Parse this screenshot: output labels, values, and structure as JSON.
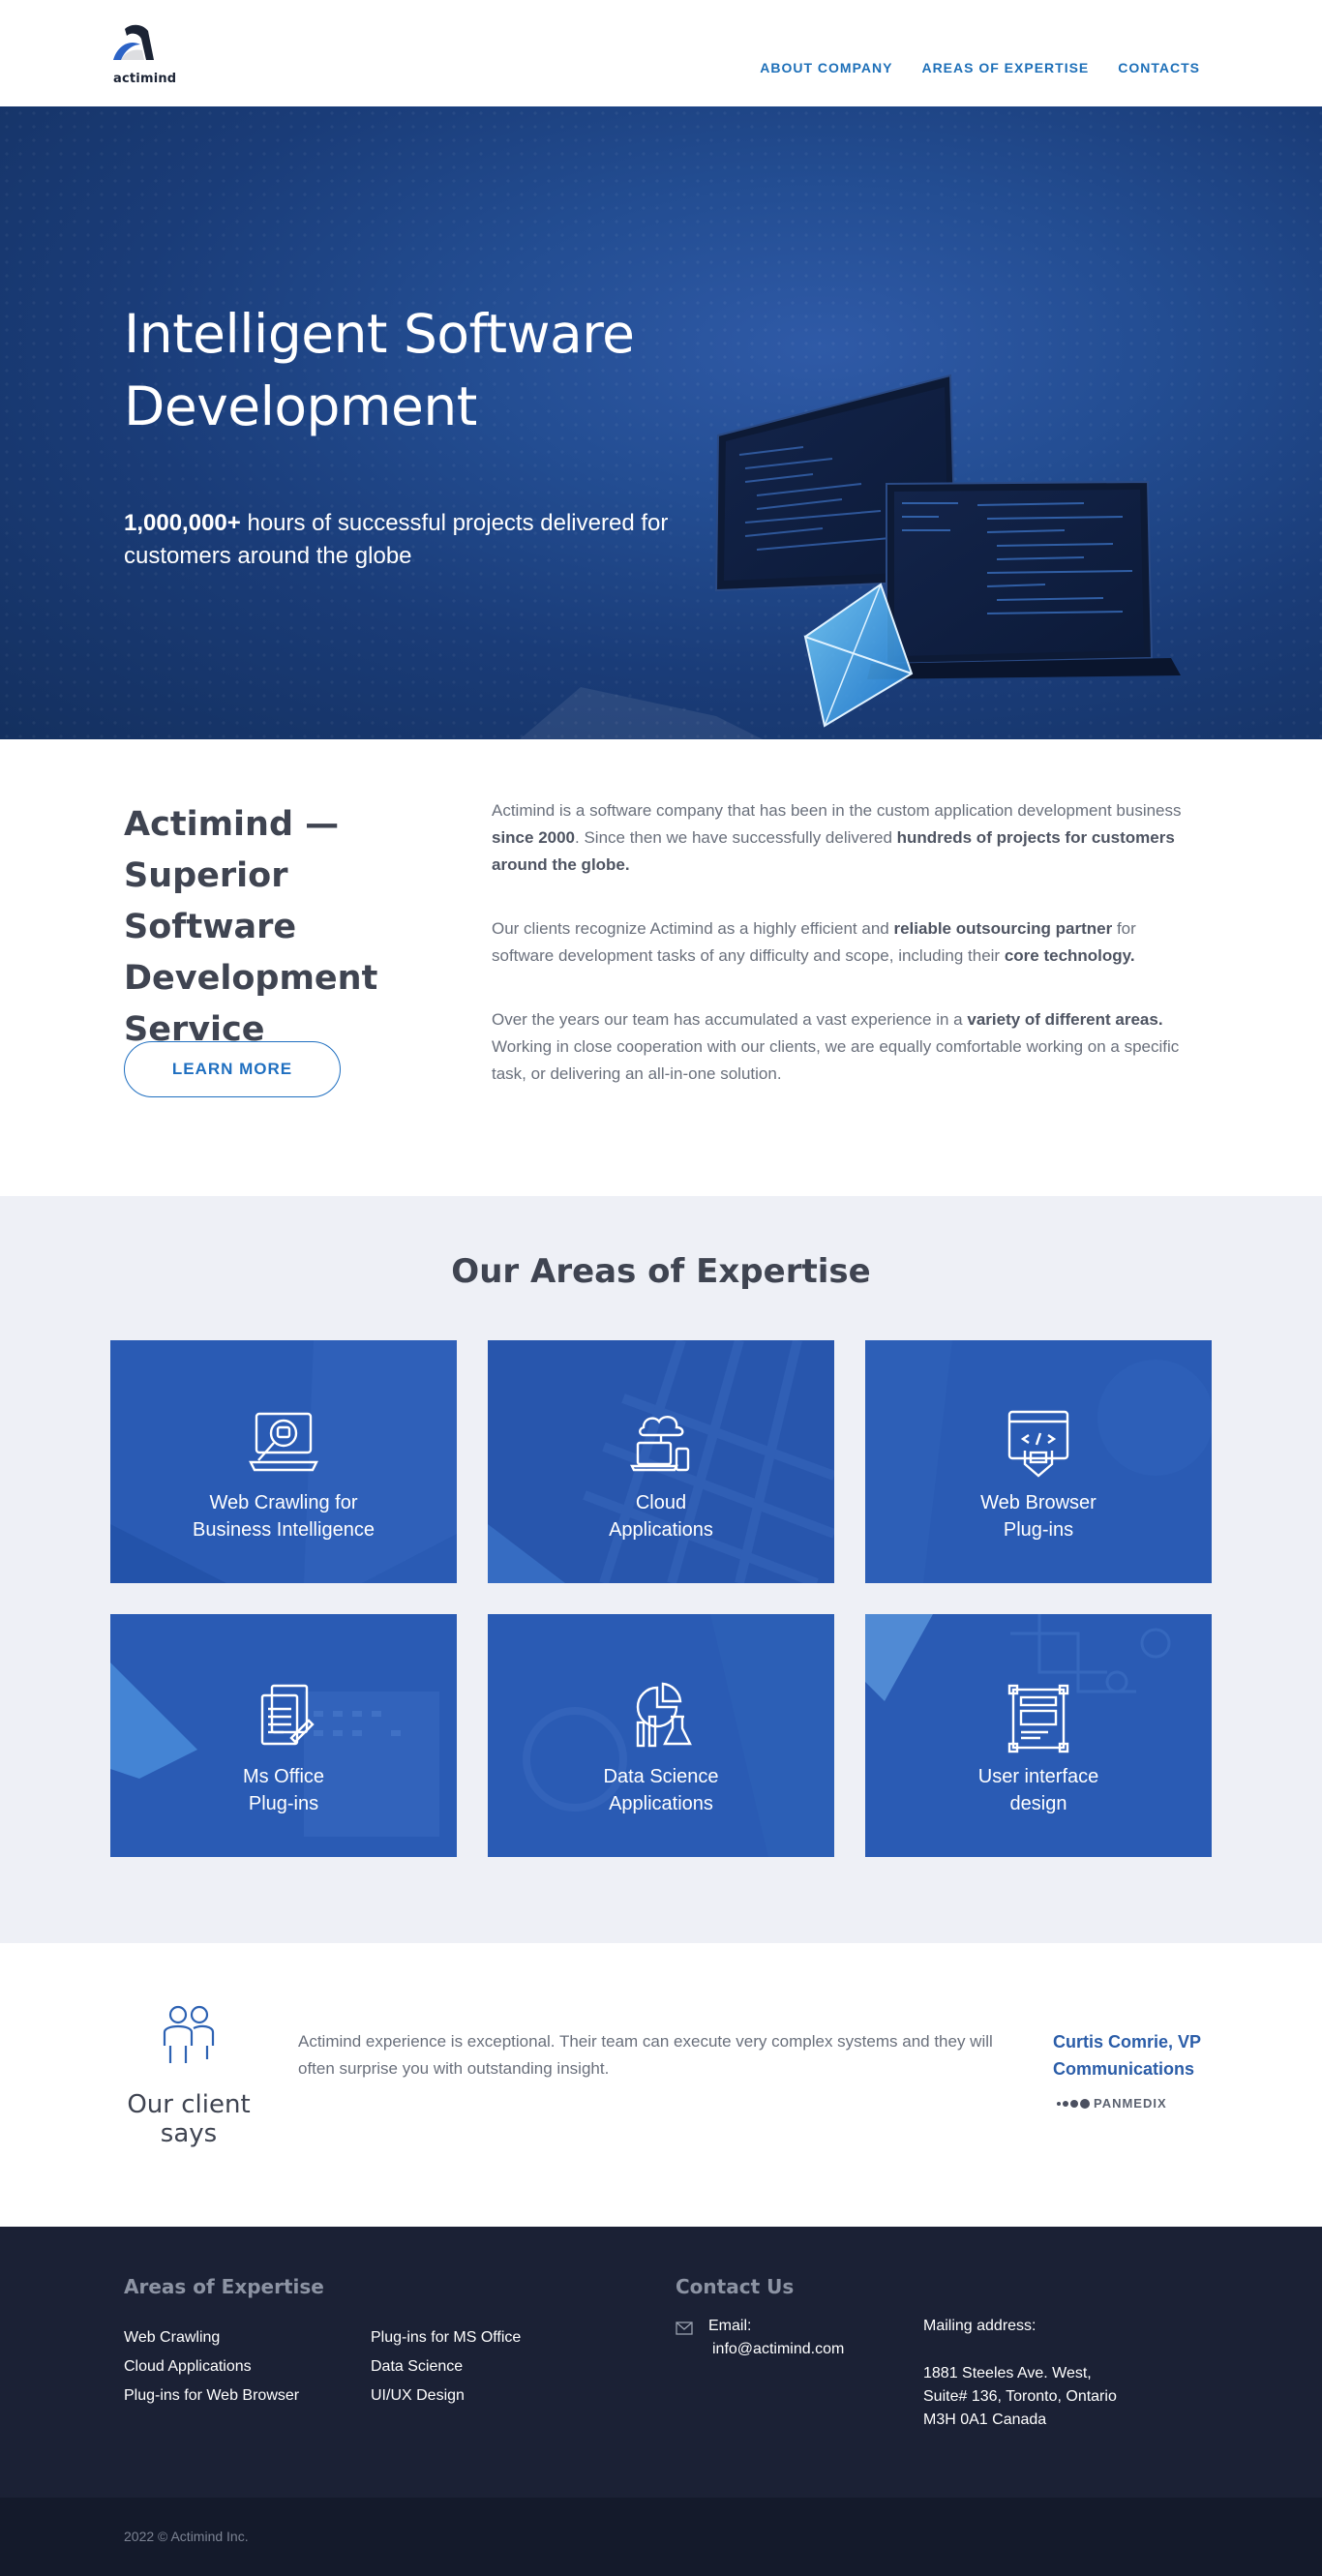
{
  "header": {
    "logo_text": "actimind",
    "nav": [
      "ABOUT COMPANY",
      "AREAS OF EXPERTISE",
      "CONTACTS"
    ]
  },
  "hero": {
    "title": "Intelligent Software Development",
    "subtitle_bold": "1,000,000+",
    "subtitle_rest": " hours of successful projects delivered for customers around the globe"
  },
  "about": {
    "title": "Actimind — Superior Software Development Service",
    "button": "LEARN MORE",
    "p1": {
      "a": "Actimind is a software company that has been in the custom application development business ",
      "b": "since 2000",
      "c": ". Since then we have successfully delivered ",
      "d": "hundreds of projects for customers around the globe."
    },
    "p2": {
      "a": "Our clients recognize Actimind as a highly efficient and ",
      "b": "reliable outsourcing partner",
      "c": " for software development tasks of any difficulty and scope, including their ",
      "d": "core technology."
    },
    "p3": {
      "a": "Over the years our team has accumulated a vast experience in a ",
      "b": "variety of different areas.",
      "c": " Working in close cooperation with our clients, we are equally comfortable working on a specific task, or delivering an all-in-one solution."
    }
  },
  "expertise": {
    "title": "Our Areas of Expertise",
    "cards": [
      {
        "line1": "Web Crawling for",
        "line2": "Business Intelligence",
        "icon": "web-crawling-icon"
      },
      {
        "line1": "Cloud",
        "line2": "Applications",
        "icon": "cloud-icon"
      },
      {
        "line1": "Web Browser",
        "line2": "Plug-ins",
        "icon": "browser-code-icon"
      },
      {
        "line1": "Ms Office",
        "line2": "Plug-ins",
        "icon": "documents-icon"
      },
      {
        "line1": "Data Science",
        "line2": "Applications",
        "icon": "data-science-icon"
      },
      {
        "line1": "User interface",
        "line2": "design",
        "icon": "ui-design-icon"
      }
    ]
  },
  "testimonial": {
    "label": "Our client says",
    "quote": "Actimind experience is exceptional. Their team can execute very complex systems and they will often surprise you with outstanding insight.",
    "author": "Curtis Comrie, VP Communications",
    "company": "PANMEDIX"
  },
  "footer": {
    "areas_heading": "Areas of Expertise",
    "areas_col1": [
      "Web Crawling",
      "Cloud Applications",
      "Plug-ins for Web Browser"
    ],
    "areas_col2": [
      "Plug-ins for MS Office",
      "Data Science",
      "UI/UX Design"
    ],
    "contact_heading": "Contact Us",
    "email_label": "Email:",
    "email": "info@actimind.com",
    "mailing_label": "Mailing address:",
    "address": [
      "1881 Steeles Ave. West,",
      "Suite# 136, Toronto, Ontario",
      "M3H 0A1 Canada"
    ],
    "copyright": "2022 © Actimind Inc."
  },
  "colors": {
    "accent": "#1d6fb8",
    "hero_bg": "#1a3c78",
    "card_blue": "#2a5bb4",
    "section_bg": "#eef0f6",
    "footer_bg": "#1b2135",
    "footer_bottom_bg": "#141a2b"
  }
}
